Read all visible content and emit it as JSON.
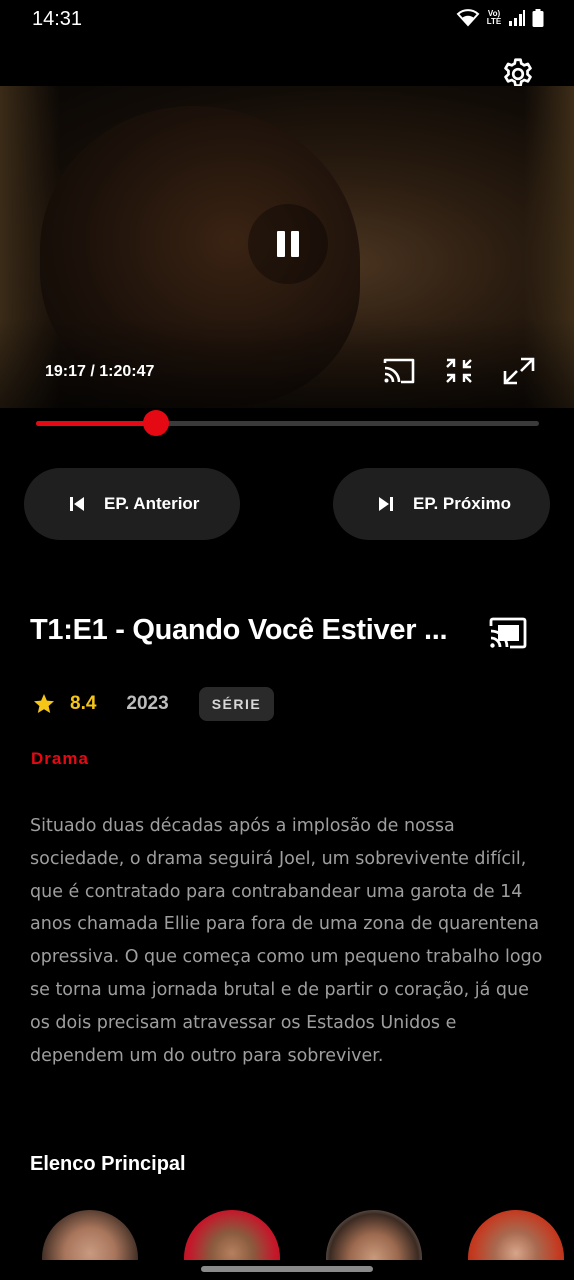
{
  "status_bar": {
    "time": "14:31",
    "volte_label": "Vo)) LTE"
  },
  "player": {
    "current_time": "19:17",
    "duration": "1:20:47",
    "timecode": "19:17 / 1:20:47",
    "progress_fraction": 0.238,
    "accent_color": "#e50914",
    "controls": [
      "cast-icon",
      "fit-screen-icon",
      "fullscreen-icon"
    ],
    "center_control": "pause-icon",
    "top_right_control": "gear-icon"
  },
  "episode_nav": {
    "prev_label": "EP. Anterior",
    "next_label": "EP. Próximo"
  },
  "details": {
    "title": "T1:E1 - Quando Você Estiver ...",
    "rating": "8.4",
    "year": "2023",
    "type_badge": "SÉRIE",
    "genre": "Drama",
    "synopsis": "Situado duas décadas após a implosão de nossa sociedade, o drama seguirá Joel, um sobrevivente difícil, que é contratado para contrabandear uma garota de 14 anos chamada Ellie para fora de uma zona de quarentena opressiva. O que começa como um pequeno trabalho logo se torna uma jornada brutal e de partir o coração, já que os dois precisam atravessar os Estados Unidos e dependem um do outro para sobreviver."
  },
  "cast": {
    "heading": "Elenco Principal",
    "count_visible": 4
  }
}
